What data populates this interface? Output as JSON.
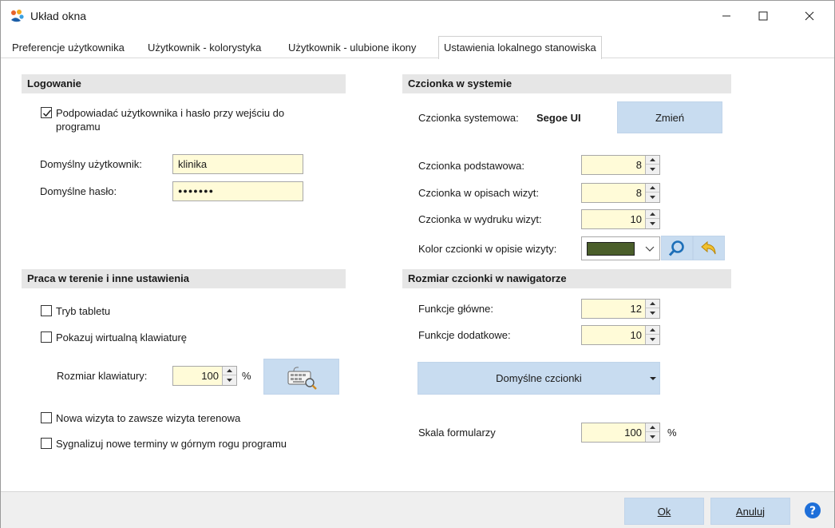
{
  "window": {
    "title": "Układ okna",
    "minimize_icon": "minimize-icon",
    "maximize_icon": "maximize-icon",
    "close_icon": "close-icon"
  },
  "tabs": [
    {
      "label": "Preferencje użytkownika",
      "active": false
    },
    {
      "label": "Użytkownik - kolorystyka",
      "active": false
    },
    {
      "label": "Użytkownik - ulubione ikony",
      "active": false
    },
    {
      "label": "Ustawienia lokalnego stanowiska",
      "active": true
    }
  ],
  "login": {
    "header": "Logowanie",
    "remember_label": "Podpowiadać użytkownika i hasło przy wejściu do programu",
    "remember_checked": true,
    "default_user_label": "Domyślny użytkownik:",
    "default_user_value": "klinika",
    "default_password_label": "Domyślne hasło:",
    "default_password_value": "●●●●●●●"
  },
  "field": {
    "header": "Praca w terenie i inne ustawienia",
    "tablet_mode_label": "Tryb tabletu",
    "tablet_mode_checked": false,
    "virtual_keyboard_label": "Pokazuj wirtualną klawiaturę",
    "virtual_keyboard_checked": false,
    "keyboard_size_label": "Rozmiar klawiatury:",
    "keyboard_size_value": "100",
    "keyboard_size_unit": "%",
    "field_visit_label": "Nowa wizyta to zawsze wizyta terenowa",
    "field_visit_checked": false,
    "signal_label": "Sygnalizuj nowe terminy w górnym rogu programu",
    "signal_checked": false,
    "keyboard_preview_icon": "keyboard-magnifier-icon"
  },
  "font": {
    "header": "Czcionka w systemie",
    "system_font_label": "Czcionka systemowa:",
    "system_font_value": "Segoe UI",
    "change_button": "Zmień",
    "base_font_label": "Czcionka podstawowa:",
    "base_font_value": "8",
    "visit_desc_font_label": "Czcionka w opisach wizyt:",
    "visit_desc_font_value": "8",
    "visit_print_font_label": "Czcionka w wydruku wizyt:",
    "visit_print_font_value": "10",
    "visit_color_label": "Kolor czcionki w opisie wizyty:",
    "visit_color_value": "#4a5e2a",
    "search_icon": "magnifier-icon",
    "undo_icon": "undo-arrow-icon"
  },
  "navigator": {
    "header": "Rozmiar czcionki w nawigatorze",
    "main_functions_label": "Funkcje główne:",
    "main_functions_value": "12",
    "extra_functions_label": "Funkcje dodatkowe:",
    "extra_functions_value": "10",
    "default_fonts_button": "Domyślne czcionki",
    "form_scale_label": "Skala formularzy",
    "form_scale_value": "100",
    "form_scale_unit": "%"
  },
  "footer": {
    "ok_label": "Ok",
    "cancel_label": "Anuluj",
    "help_icon": "help-icon"
  },
  "colors": {
    "input_bg": "#fffbd8",
    "button_bg": "#c8dcf0",
    "section_bg": "#e6e6e6",
    "help_blue": "#1e6fd9"
  }
}
